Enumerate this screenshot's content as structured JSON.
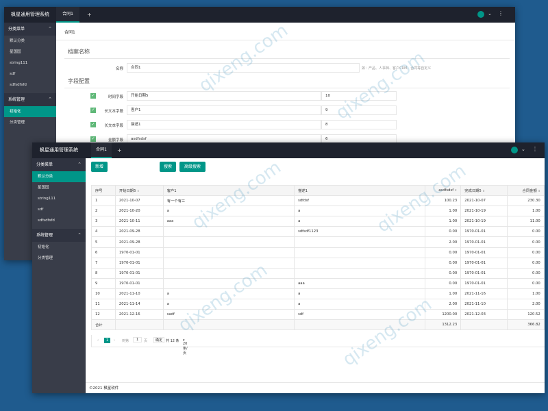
{
  "back_window": {
    "app_title": "枫星通用管理系统",
    "tab_label": "合同1",
    "plus": "+",
    "sidebar_group1": "分类菜单",
    "sidebar_items1": [
      "默认分类",
      "星国国",
      "string111",
      "sdf",
      "sdfsdfsfd"
    ],
    "sidebar_group2": "系统管理",
    "sidebar_items2": [
      "初始化",
      "分类管理"
    ],
    "form_tab": "合同1",
    "section1_title": "档案名称",
    "name_label": "名称",
    "name_value": "合同1",
    "name_hint": "如：产品、人事档、客户CRM、合同等自定义",
    "section2_title": "字段配置",
    "fields": [
      {
        "label": "时间字段",
        "name": "开始日期5",
        "order": "10"
      },
      {
        "label": "长文本字段",
        "name": "客户1",
        "order": "9"
      },
      {
        "label": "长文本字段",
        "name": "描述1",
        "order": "8"
      },
      {
        "label": "金额字段",
        "name": "asdfsdsf",
        "order": "6"
      }
    ],
    "check": "✓"
  },
  "front_window": {
    "app_title": "枫星通用管理系统",
    "tab_label": "合同1",
    "plus": "+",
    "sidebar_group1": "分类菜单",
    "sidebar_items1": [
      "默认分类",
      "星国国",
      "string111",
      "sdf",
      "sdfsdfsfd"
    ],
    "sidebar_group2": "系统管理",
    "sidebar_items2": [
      "初始化",
      "分类管理"
    ],
    "btn_add": "新增",
    "btn_search": "搜索",
    "btn_adv_search": "高级搜索",
    "columns": [
      "序号",
      "开始日期5",
      "客户1",
      "描述1",
      "asdfsdsf",
      "完成日期5",
      "合同金额",
      "操作"
    ],
    "rows": [
      [
        "1",
        "2021-10-07",
        "有一个有三",
        "sdfdsf",
        "100.23",
        "2021-10-07",
        "230.30"
      ],
      [
        "2",
        "2021-10-20",
        "a",
        "a",
        "1.00",
        "2021-10-19",
        "1.00"
      ],
      [
        "3",
        "2021-10-11",
        "aaa",
        "a",
        "1.00",
        "2021-10-19",
        "11.00"
      ],
      [
        "4",
        "2021-09-28",
        "",
        "sdfsdf1123",
        "0.00",
        "1970-01-01",
        "0.00"
      ],
      [
        "5",
        "2021-09-28",
        "",
        "",
        "2.00",
        "1970-01-01",
        "0.00"
      ],
      [
        "6",
        "1970-01-01",
        "",
        "",
        "0.00",
        "1970-01-01",
        "0.00"
      ],
      [
        "7",
        "1970-01-01",
        "",
        "",
        "0.00",
        "1970-01-01",
        "0.00"
      ],
      [
        "8",
        "1970-01-01",
        "",
        "",
        "0.00",
        "1970-01-01",
        "0.00"
      ],
      [
        "9",
        "1970-01-01",
        "",
        "aaa",
        "0.00",
        "1970-01-01",
        "0.00"
      ],
      [
        "10",
        "2021-11-10",
        "a",
        "a",
        "1.00",
        "2021-11-16",
        "1.00"
      ],
      [
        "11",
        "2021-11-14",
        "a",
        "a",
        "2.00",
        "2021-11-10",
        "2.00"
      ],
      [
        "12",
        "2021-12-16",
        "sadf",
        "sdf",
        "1200.00",
        "2021-12-03",
        "120.52"
      ]
    ],
    "edit_label": "编辑",
    "delete_label": "删除",
    "total_label": "合计",
    "total_asdf": "1312.23",
    "total_amount": "366.82",
    "pager": {
      "prev": "‹",
      "current": "1",
      "next": "›",
      "goto": "到第",
      "page_input": "1",
      "unit": "页",
      "confirm": "确定",
      "total": "共 12 条",
      "per_page": "20 条/页"
    },
    "footer": "©2021 枫星软件"
  },
  "watermark": "qixeng.com"
}
